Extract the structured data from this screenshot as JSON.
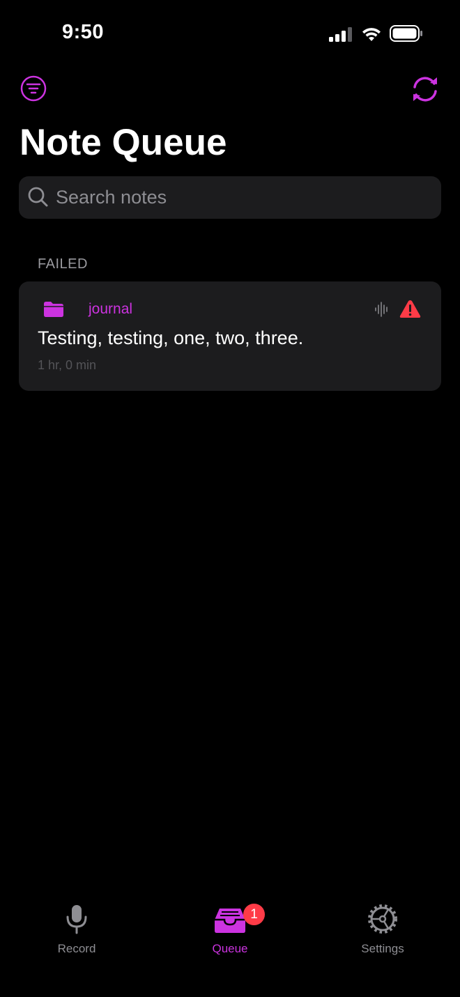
{
  "status_bar": {
    "time": "9:50"
  },
  "header": {
    "title": "Note Queue",
    "filter_icon": "filter-icon",
    "sync_icon": "sync-icon"
  },
  "search": {
    "placeholder": "Search notes",
    "value": ""
  },
  "sections": [
    {
      "header": "FAILED",
      "notes": [
        {
          "folder": "journal",
          "text": "Testing, testing, one, two, three.",
          "time": "1 hr, 0 min",
          "status": "failed",
          "icons": [
            "folder-icon",
            "waveform-icon",
            "warning-icon"
          ]
        }
      ]
    }
  ],
  "tab_bar": {
    "tabs": [
      {
        "label": "Record",
        "icon": "microphone-icon",
        "selected": false
      },
      {
        "label": "Queue",
        "icon": "tray-icon",
        "selected": true,
        "badge": "1"
      },
      {
        "label": "Settings",
        "icon": "gear-icon",
        "selected": false
      }
    ]
  },
  "colors": {
    "accent": "#cc33e0",
    "background": "#000000",
    "card": "#1c1c1e",
    "warning": "#ff3b47",
    "secondary_text": "#8e8e93"
  }
}
